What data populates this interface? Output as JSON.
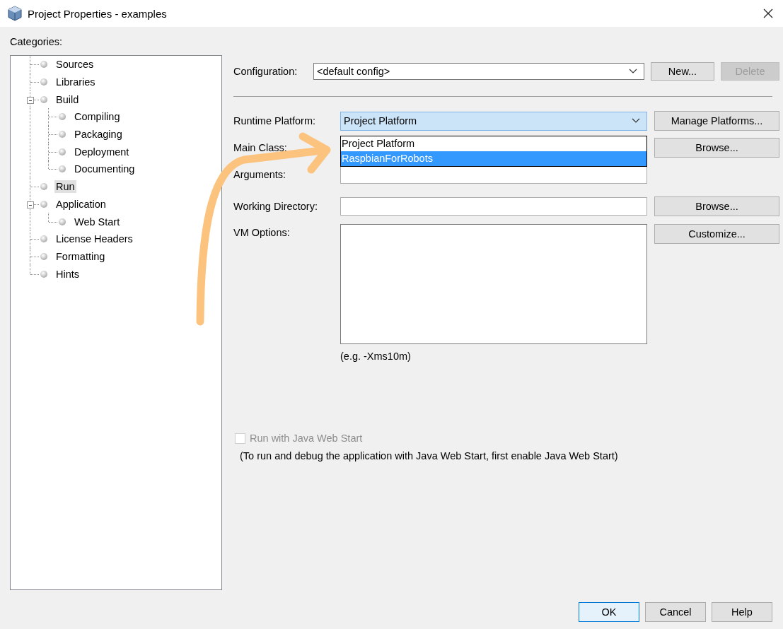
{
  "window": {
    "title": "Project Properties - examples"
  },
  "categories": {
    "label": "Categories:",
    "items": [
      {
        "label": "Sources",
        "selected": false
      },
      {
        "label": "Libraries",
        "selected": false
      },
      {
        "label": "Build",
        "selected": false,
        "expanded": true,
        "children": [
          {
            "label": "Compiling",
            "selected": false
          },
          {
            "label": "Packaging",
            "selected": false
          },
          {
            "label": "Deployment",
            "selected": false
          },
          {
            "label": "Documenting",
            "selected": false
          }
        ]
      },
      {
        "label": "Run",
        "selected": true
      },
      {
        "label": "Application",
        "selected": false,
        "expanded": true,
        "children": [
          {
            "label": "Web Start",
            "selected": false
          }
        ]
      },
      {
        "label": "License Headers",
        "selected": false
      },
      {
        "label": "Formatting",
        "selected": false
      },
      {
        "label": "Hints",
        "selected": false
      }
    ]
  },
  "configuration": {
    "label": "Configuration:",
    "value": "<default config>",
    "buttons": [
      {
        "label": "New...",
        "disabled": false
      },
      {
        "label": "Delete",
        "disabled": true
      }
    ]
  },
  "runtime_platform": {
    "label": "Runtime Platform:",
    "value": "Project Platform",
    "expanded": true,
    "button": "Manage Platforms...",
    "options": [
      {
        "label": "Project Platform",
        "highlighted": false
      },
      {
        "label": "RaspbianForRobots",
        "highlighted": true
      }
    ]
  },
  "main_class": {
    "label": "Main Class:",
    "button": "Browse..."
  },
  "arguments": {
    "label": "Arguments:"
  },
  "working_directory": {
    "label": "Working Directory:",
    "button": "Browse..."
  },
  "vm_options": {
    "label": "VM Options:",
    "button": "Customize...",
    "hint": "(e.g. -Xms10m)"
  },
  "web_start": {
    "label": "Run with Java Web Start",
    "checked": false,
    "disabled": true,
    "note": "(To run and debug the application with Java Web Start, first enable Java Web Start)"
  },
  "footer_buttons": [
    {
      "label": "OK",
      "default": true
    },
    {
      "label": "Cancel",
      "default": false
    },
    {
      "label": "Help",
      "default": false
    }
  ]
}
